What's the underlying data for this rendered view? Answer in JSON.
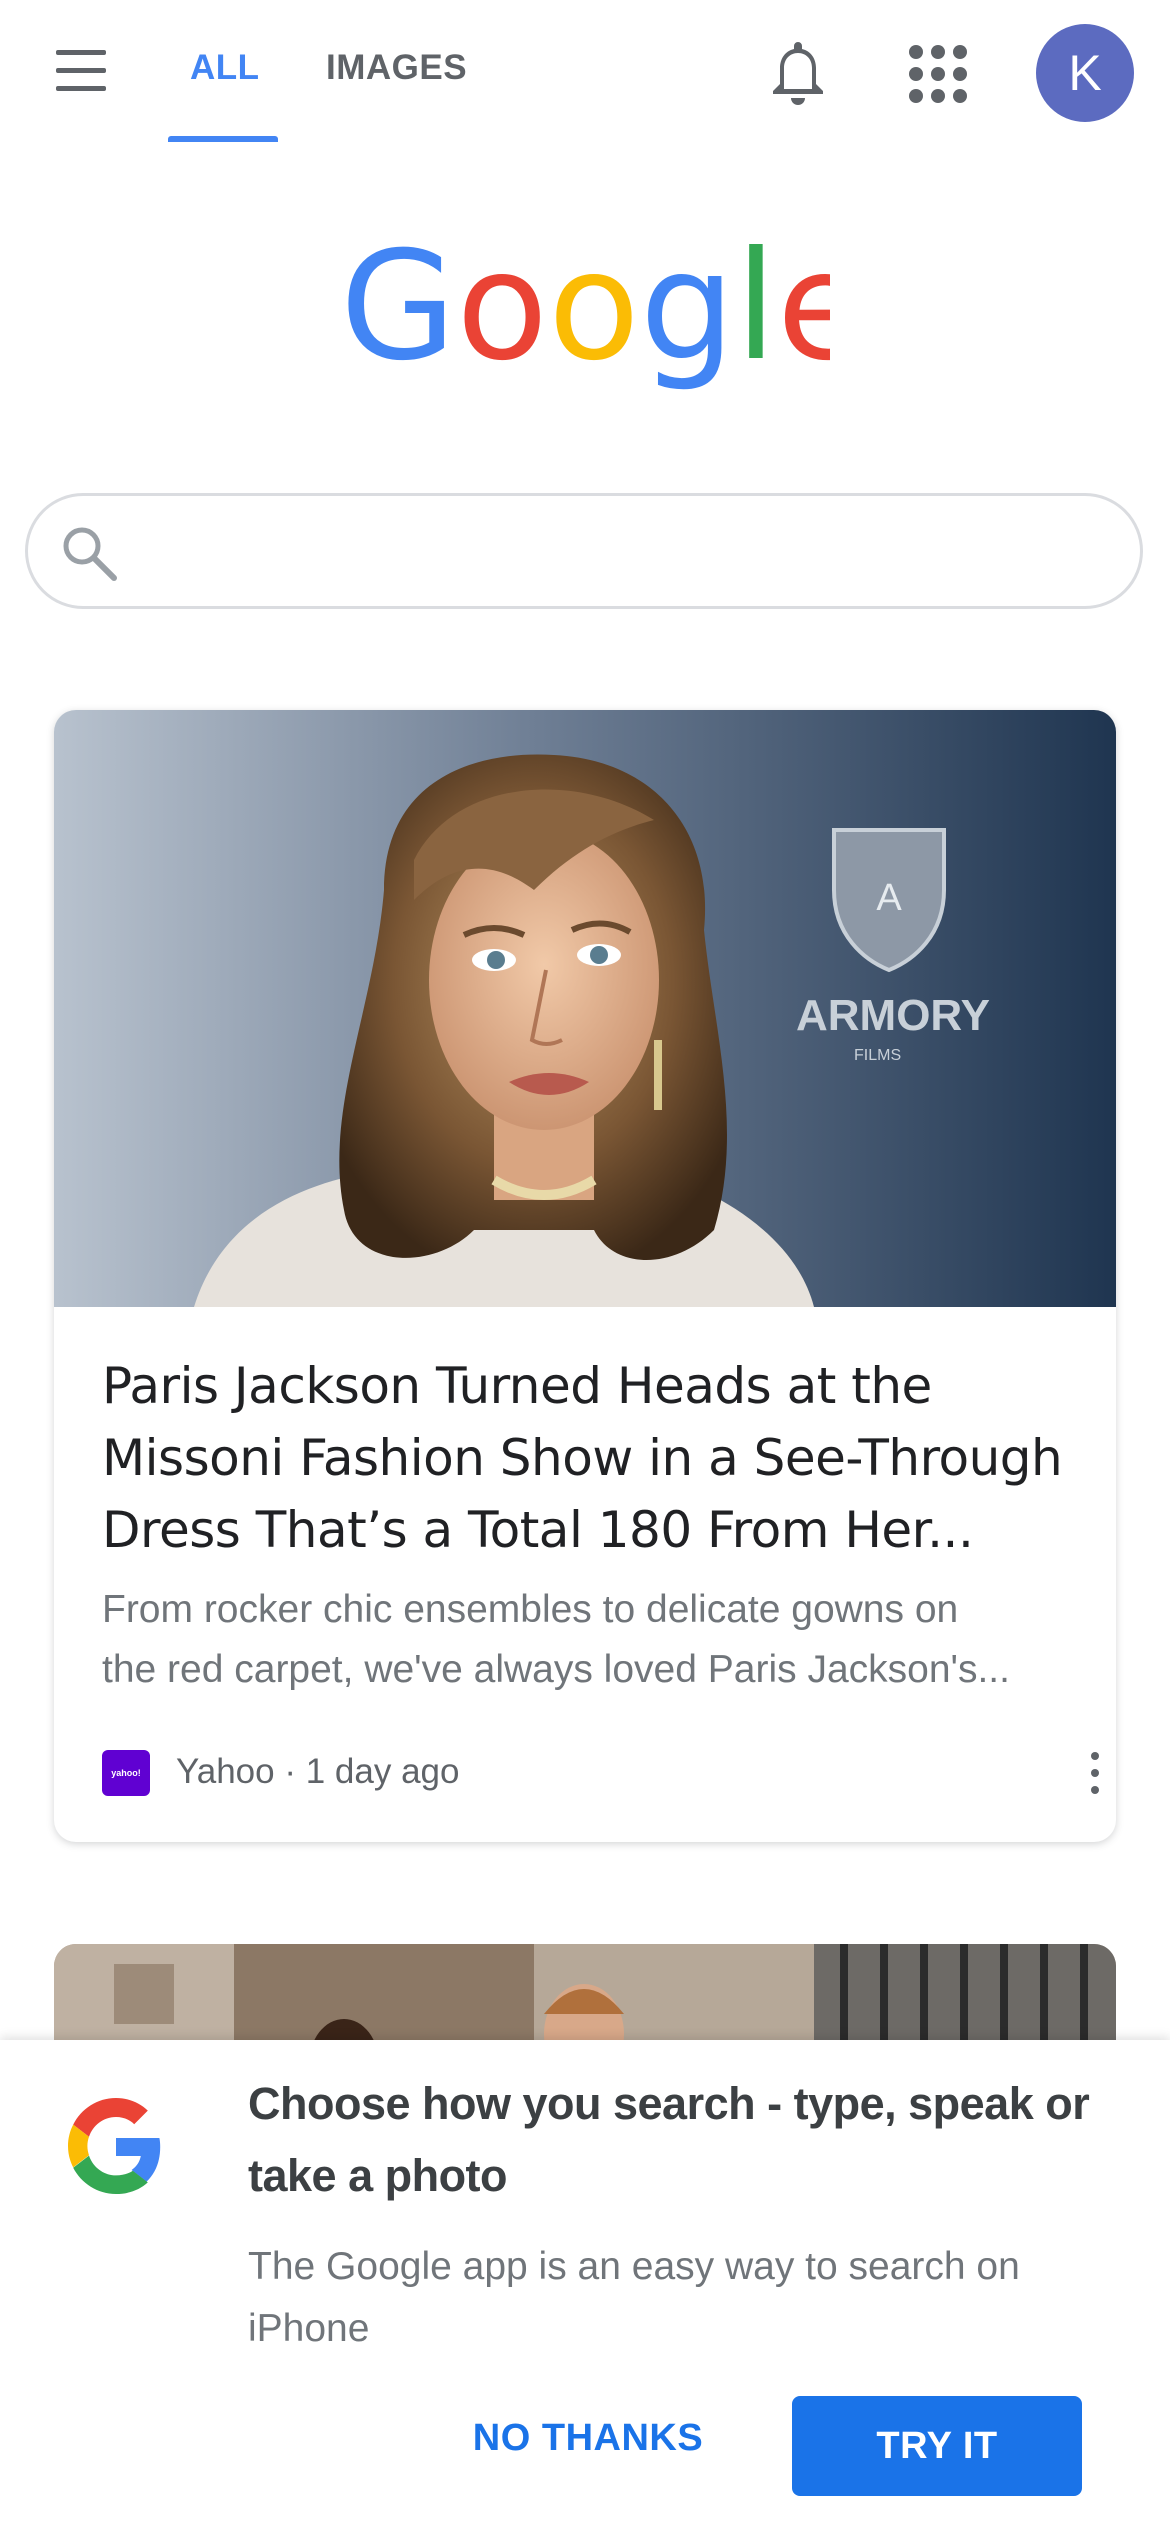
{
  "header": {
    "tabs": [
      {
        "label": "ALL",
        "active": true
      },
      {
        "label": "IMAGES",
        "active": false
      }
    ],
    "avatar_initial": "K",
    "accent_color": "#4285f4",
    "icons": [
      "menu-icon",
      "bell-icon",
      "apps-grid-icon"
    ]
  },
  "logo": {
    "letters": [
      "G",
      "o",
      "o",
      "g",
      "l",
      "e"
    ],
    "colors": [
      "#4285f4",
      "#ea4335",
      "#fbbc05",
      "#4285f4",
      "#34a853",
      "#ea4335"
    ]
  },
  "search": {
    "placeholder": "",
    "value": "",
    "icon": "search-icon"
  },
  "feed": {
    "card": {
      "title": "Paris Jackson Turned Heads at the Missoni Fashion Show in a See-Through Dress That’s a Total 180 From Her...",
      "snippet_line1": "From rocker chic ensembles to delicate gowns on",
      "snippet_line2": "the red carpet, we've always loved Paris Jackson's...",
      "source": "Yahoo",
      "age": "1 day ago",
      "source_logo_text": "yahoo!",
      "source_logo_color": "#6001d2",
      "image_backdrop_text": "ARMORY",
      "image_backdrop_subtext": "FILMS",
      "image_shield_letter": "A"
    }
  },
  "prompt": {
    "title": "Choose how you search - type, speak or take a photo",
    "description": "The Google app is an easy way to search on iPhone",
    "dismiss_label": "NO THANKS",
    "accept_label": "TRY IT",
    "button_color": "#1a73e8"
  }
}
